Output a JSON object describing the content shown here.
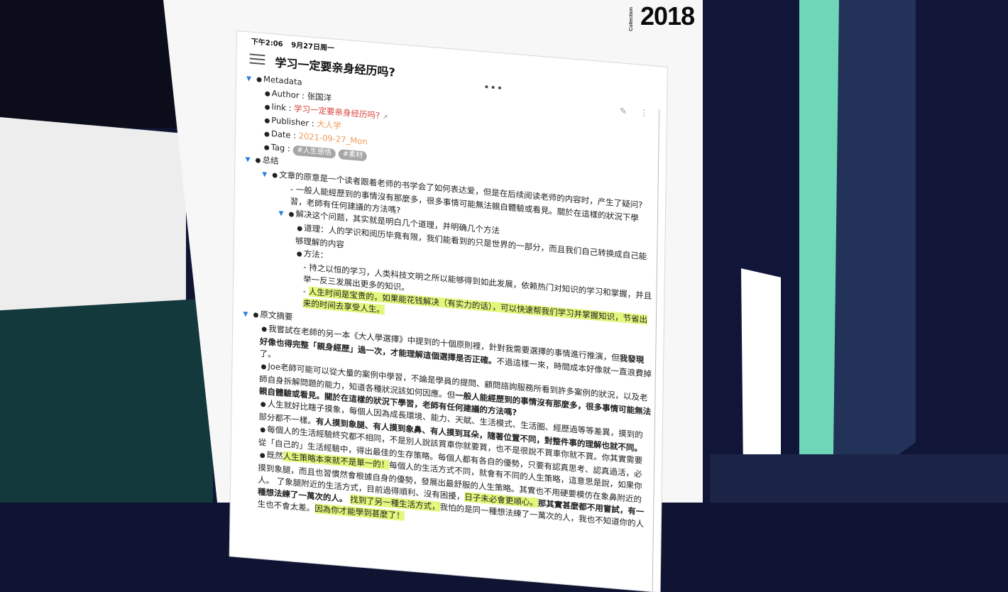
{
  "calendar": {
    "year": "2018",
    "brand": "Collection"
  },
  "status": {
    "time": "下午2:06",
    "date": "9月27日周一"
  },
  "page": {
    "title": "学习一定要亲身经历吗?",
    "more": "•••"
  },
  "metadata": {
    "label": "Metadata",
    "author_label": "Author",
    "author": "张国洋",
    "link_label": "link",
    "link": "学习一定要亲身经历吗?",
    "publisher_label": "Publisher",
    "publisher": "大人学",
    "date_label": "Date",
    "date": "2021-09-27_Mon",
    "tag_label": "Tag",
    "tags": [
      "#人生感悟",
      "#素材"
    ]
  },
  "summary": {
    "label": "总结",
    "q1": "文章的原意是一个读者跟着老师的书学会了如何表达爱，但是在后续阅读老师的内容时，产生了疑问?",
    "q1_note": "- 一般人能經歷到的事情沒有那麼多，很多事情可能無法親自體驗或看見。關於在這樣的狀況下學習，老師有任何建議的方法嗎?",
    "solve": "解决这个问题，其实就是明白几个道理，并明确几个方法",
    "principle": "道理：人的学识和阅历毕竟有限，我们能看到的只是世界的一部分，而且我们自己转换成自己能够理解的内容",
    "method": "方法：",
    "method_note1": "- 持之以恒的学习，人类科技文明之所以能够得到如此发展，依赖热门对知识的学习和掌握，并且举一反三发展出更多的知识。",
    "method_note2": "人生时间是宝贵的，如果能花钱解决（有实力的话），可以快速帮我们学习并掌握知识，节省出来的时间去享受人生。"
  },
  "excerpt": {
    "label": "原文摘要",
    "p1a": "我嘗試在老師的另一本《大人學選擇》中提到的十個原則裡，針對我需要選擇的事情進行推演，但",
    "p1b": "我發現好像也得完整「親身經歷」過一次，才能理解這個選擇是否正確。",
    "p1c": "不過這樣一來，時間成本好像就一直浪費掉了。",
    "p2a": "Joe老師可能可以從大量的案例中學習，不論是學員的提問、顧問諮詢服務所看到許多案例的狀況，以及老師自身拆解問題的能力，知道各種狀況該如何因應。但",
    "p2b": "一般人能經歷到的事情沒有那麼多，很多事情可能無法親自體驗或看見。關於在這樣的狀況下學習，老師有任何建議的方法嗎?",
    "p3a": "人生就好比瞎子摸象，每個人因為成長環境、能力、天賦、生活模式、生活圈、經歷過等等差異，摸到的部分都不一樣。",
    "p3b": "有人摸到象腿、有人摸到象鼻、有人摸到耳朵，隨著位置不同，對整件事的理解也就不同。",
    "p4a": "每個人的生活經驗終究都不相同，不是別人說該買車你就要買，也不是很說不買車你就不買。你其實需要從「自己的」生活經驗中，得出最佳的生存策略。",
    "p4b": "每個人都有各自的優勢，只要有認真思考、認真過活，必",
    "p5a": "既然",
    "p5b": "人生策略本來就不是單一的！",
    "p5c": "每個人的生活方式不同，就會有不同的人生策略，這意思是說，如果你摸到象腿，而且也習慣然會根據自身的優勢，發展出最舒服的人生策略。其實也不用硬要模仿在象鼻附近的人。",
    "p6a": "了象腿附近的生活方式，目前過得順利、沒有困擾，",
    "p6b": "日子未必會更順心。",
    "p6c": "那其實甚麼都不用嘗試，",
    "p6d": "有一種想法練了一萬次的人。",
    "p7a": "找到了另一種生活方式，",
    "p7b": "我怕的是同一種想法練了一萬次的人，我也不知道你的人生也不會太差。",
    "p7c": "因為你才能學到甚麼了！"
  }
}
